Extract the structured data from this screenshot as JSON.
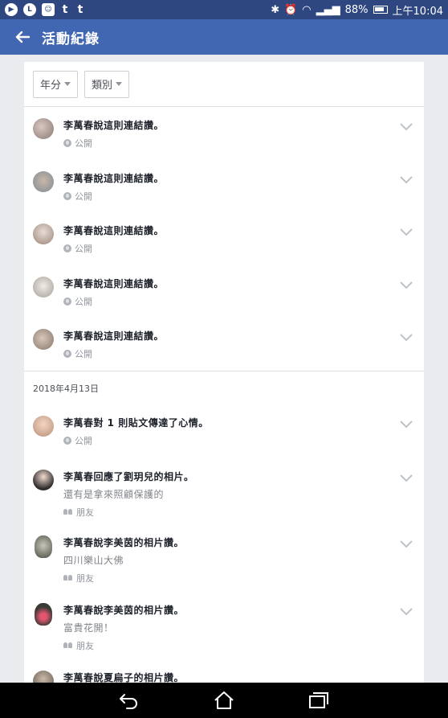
{
  "status_bar": {
    "battery": "88%",
    "time": "上午10:04",
    "left_icons": [
      "play-icon",
      "line-icon",
      "app-icon",
      "tumblr-icon",
      "tumblr-icon"
    ]
  },
  "header": {
    "title": "活動紀錄",
    "back_icon": "arrow-left-icon"
  },
  "filters": [
    {
      "label": "年分"
    },
    {
      "label": "類別"
    }
  ],
  "items_group1": [
    {
      "title": "李萬春說這則連結讚。",
      "privacy": "公開"
    },
    {
      "title": "李萬春說這則連結讚。",
      "privacy": "公開"
    },
    {
      "title": "李萬春說這則連結讚。",
      "privacy": "公開"
    },
    {
      "title": "李萬春說這則連結讚。",
      "privacy": "公開"
    },
    {
      "title": "李萬春說這則連結讚。",
      "privacy": "公開"
    }
  ],
  "date_header": "2018年4月13日",
  "items_group2": [
    {
      "title": "李萬春對 1 則貼文傳達了心情。",
      "subtitle": "",
      "privacy": "公開"
    },
    {
      "title": "李萬春回應了劉玥兒的相片。",
      "subtitle": "還有是拿來照顧保護的",
      "privacy": "朋友"
    },
    {
      "title": "李萬春說李美茵的相片讚。",
      "subtitle": "四川樂山大佛",
      "privacy": "朋友"
    },
    {
      "title": "李萬春說李美茵的相片讚。",
      "subtitle": "富貴花開！",
      "privacy": "朋友"
    },
    {
      "title": "李萬春說夏扁子的相片讚。",
      "subtitle": "",
      "privacy": ""
    }
  ],
  "colors": {
    "header": "#4267b2",
    "status": "#2e4781",
    "background": "#e9ebee"
  }
}
